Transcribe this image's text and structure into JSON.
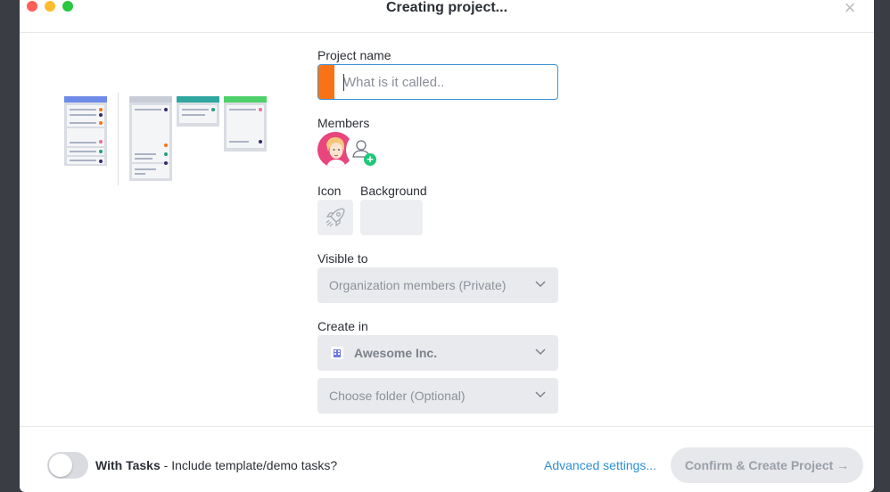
{
  "window": {
    "title": "Creating project..."
  },
  "form": {
    "project_name_label": "Project name",
    "project_name_placeholder": "What is it called..",
    "project_name_value": "",
    "color_accent": "#f97316",
    "members_label": "Members",
    "icon_label": "Icon",
    "background_label": "Background",
    "visible_to_label": "Visible to",
    "visible_to_value": "Organization members (Private)",
    "create_in_label": "Create in",
    "create_in_value": "Awesome Inc.",
    "folder_placeholder": "Choose folder (Optional)"
  },
  "footer": {
    "with_tasks_bold": "With Tasks",
    "with_tasks_desc": " - Include template/demo tasks?",
    "advanced_settings": "Advanced settings...",
    "confirm_button": "Confirm & Create Project →"
  },
  "icons": [
    "close-icon",
    "rocket-icon",
    "add-user-icon",
    "building-icon",
    "chevron-down-icon"
  ]
}
